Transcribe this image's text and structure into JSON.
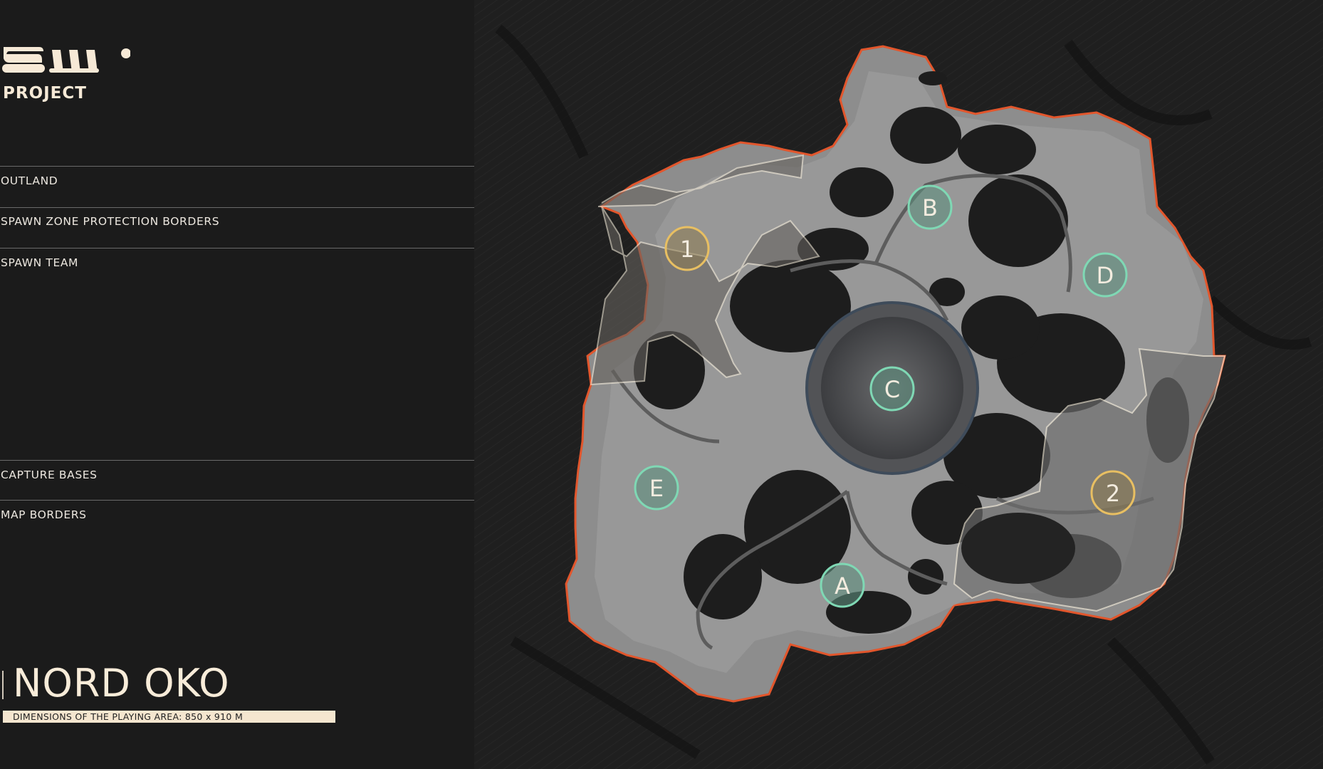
{
  "logo": {
    "text": "PROJECT"
  },
  "legend": [
    {
      "label": "OUTLAND"
    },
    {
      "label": "SPAWN ZONE PROTECTION BORDERS"
    },
    {
      "label": "SPAWN TEAM"
    },
    {
      "label": "CAPTURE BASES"
    },
    {
      "label": "MAP BORDERS"
    }
  ],
  "map": {
    "name": "NORD OKO",
    "dimensions": "DIMENSIONS OF THE PLAYING AREA: 850 x 910 M",
    "capture_bases": [
      {
        "label": "A"
      },
      {
        "label": "B"
      },
      {
        "label": "C"
      },
      {
        "label": "D"
      },
      {
        "label": "E"
      }
    ],
    "spawn_teams": [
      {
        "label": "1"
      },
      {
        "label": "2"
      }
    ]
  },
  "colors": {
    "background": "#1a1a1a",
    "map_border": "#e2562c",
    "spawn_border": "#f2ead8",
    "capture_base": "#7fd8b4",
    "spawn_team": "#e8bf62",
    "accent": "#f5e6cf"
  }
}
